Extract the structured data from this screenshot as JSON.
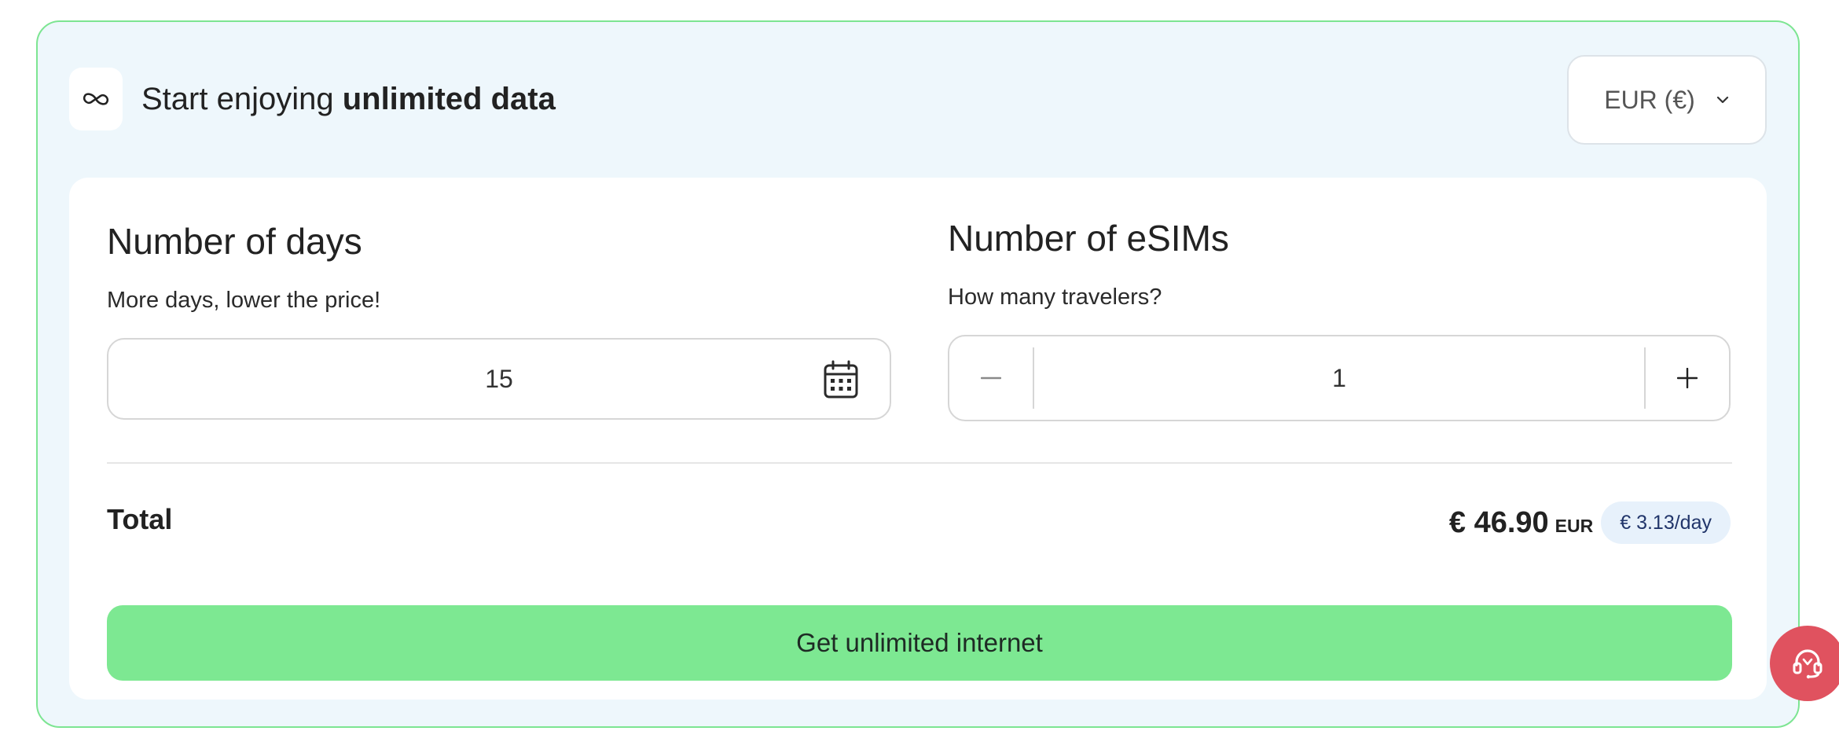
{
  "header": {
    "logo_icon": "infinity-icon",
    "title_prefix": "Start enjoying ",
    "title_bold": "unlimited data"
  },
  "currency_select": {
    "selected": "EUR (€)",
    "icon": "chevron-down-icon"
  },
  "days": {
    "title": "Number of days",
    "subtitle": "More days, lower the price!",
    "value": "15",
    "icon": "calendar-icon"
  },
  "esims": {
    "title": "Number of eSIMs",
    "subtitle": "How many travelers?",
    "quantity": "1",
    "minus_icon": "minus-icon",
    "plus_icon": "plus-icon"
  },
  "total": {
    "label": "Total",
    "price": "€ 46.90",
    "currency": "EUR",
    "per_day": "€ 3.13/day"
  },
  "cta": {
    "label": "Get unlimited internet"
  },
  "support": {
    "icon": "headset-icon"
  },
  "colors": {
    "accent_green": "#7de892",
    "border_green": "#7de592",
    "card_background": "#eef7fc",
    "support_red": "#e0525f",
    "per_day_badge": "#e7f1fb"
  }
}
